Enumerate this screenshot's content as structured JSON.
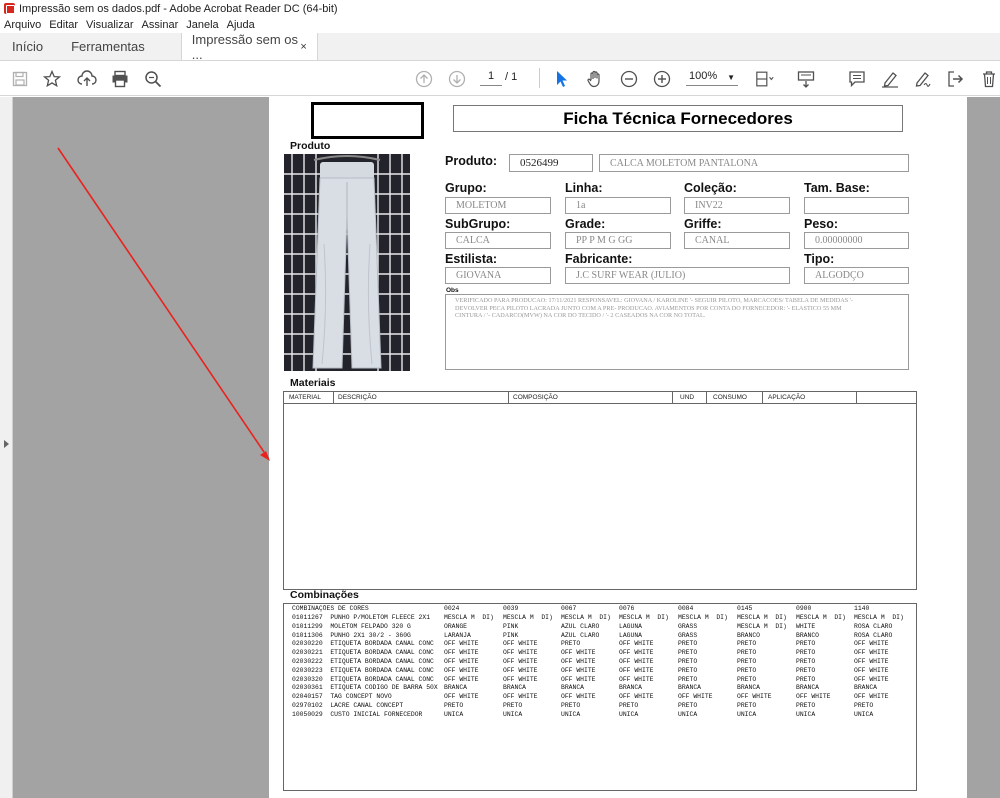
{
  "window": {
    "title": "Impressão sem os dados.pdf - Adobe Acrobat Reader DC (64-bit)"
  },
  "menu": [
    "Arquivo",
    "Editar",
    "Visualizar",
    "Assinar",
    "Janela",
    "Ajuda"
  ],
  "tabs": {
    "home": "Início",
    "tools": "Ferramentas",
    "doc": "Impressão sem os ...",
    "close": "×"
  },
  "toolbar": {
    "page_current": "1",
    "page_total": "/ 1",
    "zoom": "100%"
  },
  "form": {
    "title": "Ficha Técnica Fornecedores",
    "section_product": "Produto",
    "produto_label": "Produto:",
    "produto_code": "0526499",
    "produto_name": "CALCA MOLETOM PANTALONA",
    "grupo_label": "Grupo:",
    "grupo": "MOLETOM",
    "linha_label": "Linha:",
    "linha": "1a",
    "colecao_label": "Coleção:",
    "colecao": "INV22",
    "tambase_label": "Tam. Base:",
    "tambase": "",
    "subgrupo_label": "SubGrupo:",
    "subgrupo": "CALCA",
    "grade_label": "Grade:",
    "grade": "PP P M G GG",
    "griffe_label": "Griffe:",
    "griffe": "CANAL",
    "peso_label": "Peso:",
    "peso": "0.00000000",
    "estilista_label": "Estilista:",
    "estilista": "GIOVANA",
    "fabricante_label": "Fabricante:",
    "fabricante": "J.C SURF WEAR (JULIO)",
    "tipo_label": "Tipo:",
    "tipo": "ALGODÇO",
    "obs_label": "Obs",
    "obs_lines": [
      "VERIFICADO PARA PRODUCAO: 17/11/2021 RESPONSAVEL: GIOVANA / KAROLINE '- SEGUIR PILOTO, MARCACOES/ TABELA DE MEDIDAS '-",
      "DEVOLVER PECA PILOTO LACRADA JUNTO COM A PRE- PRODUCAO.  AVIAMENTOS POR CONTA DO FORNECEDOR: '- ELASTICO 55 MM",
      "CINTURA / '- CADARCO(MVW)  NA COR DO TECIDO / '- 2 CASEADOS NA COR NO TOTAL."
    ]
  },
  "materiais": {
    "title": "Materiais",
    "columns": [
      "MATERIAL",
      "DESCRIÇÃO",
      "COMPOSIÇÃO",
      "UND",
      "CONSUMO",
      "APLICAÇÃO"
    ]
  },
  "combinacoes": {
    "title": "Combinações",
    "header": [
      "COMBINAÇÕES DE CORES",
      "0024",
      "0039",
      "0067",
      "0076",
      "0084",
      "0145",
      "0900",
      "1140"
    ],
    "rows": [
      [
        "01011267  PUNHO P/MOLETOM FLEECE 2X1",
        "MESCLA M  DI)",
        "MESCLA M  DI)",
        "MESCLA M  DI)",
        "MESCLA M  DI)",
        "MESCLA M  DI)",
        "MESCLA M  DI)",
        "MESCLA M  DI)",
        "MESCLA M  DI)"
      ],
      [
        "01011299  MOLETOM FELPADO 320 G",
        "ORANGE",
        "PINK",
        "AZUL CLARO",
        "LAGUNA",
        "GRASS",
        "MESCLA M  DI)",
        "WHITE",
        "ROSA CLARO"
      ],
      [
        "01011306  PUNHO 2X1 30/2 - 360G",
        "LARANJA",
        "PINK",
        "AZUL CLARO",
        "LAGUNA",
        "GRASS",
        "BRANCO",
        "BRANCO",
        "ROSA CLARO"
      ],
      [
        "02030220  ETIQUETA BORDADA CANAL CONC",
        "OFF WHITE",
        "OFF WHITE",
        "PRETO",
        "OFF WHITE",
        "PRETO",
        "PRETO",
        "PRETO",
        "OFF WHITE"
      ],
      [
        "02030221  ETIQUETA BORDADA CANAL CONC",
        "OFF WHITE",
        "OFF WHITE",
        "OFF WHITE",
        "OFF WHITE",
        "PRETO",
        "PRETO",
        "PRETO",
        "OFF WHITE"
      ],
      [
        "02030222  ETIQUETA BORDADA CANAL CONC",
        "OFF WHITE",
        "OFF WHITE",
        "OFF WHITE",
        "OFF WHITE",
        "PRETO",
        "PRETO",
        "PRETO",
        "OFF WHITE"
      ],
      [
        "02030223  ETIQUETA BORDADA CANAL CONC",
        "OFF WHITE",
        "OFF WHITE",
        "OFF WHITE",
        "OFF WHITE",
        "PRETO",
        "PRETO",
        "PRETO",
        "OFF WHITE"
      ],
      [
        "02030320  ETIQUETA BORDADA CANAL CONC",
        "OFF WHITE",
        "OFF WHITE",
        "OFF WHITE",
        "OFF WHITE",
        "PRETO",
        "PRETO",
        "PRETO",
        "OFF WHITE"
      ],
      [
        "02030361  ETIQUETA CODIGO DE BARRA 50X",
        "BRANCA",
        "BRANCA",
        "BRANCA",
        "BRANCA",
        "BRANCA",
        "BRANCA",
        "BRANCA",
        "BRANCA"
      ],
      [
        "02040157  TAG CONCEPT NOVO",
        "OFF WHITE",
        "OFF WHITE",
        "OFF WHITE",
        "OFF WHITE",
        "OFF WHITE",
        "OFF WHITE",
        "OFF WHITE",
        "OFF WHITE"
      ],
      [
        "02970102  LACRE CANAL CONCEPT",
        "PRETO",
        "PRETO",
        "PRETO",
        "PRETO",
        "PRETO",
        "PRETO",
        "PRETO",
        "PRETO"
      ],
      [
        "10050029  CUSTO INICIAL FORNECEDOR",
        "UNICA",
        "UNICA",
        "UNICA",
        "UNICA",
        "UNICA",
        "UNICA",
        "UNICA",
        "UNICA"
      ]
    ]
  },
  "colors": {
    "annotation_arrow": "#e8231f",
    "acrobat_red": "#d8281e",
    "selected_tool": "#1473e6"
  },
  "icons": [
    "save-icon",
    "bookmark-star-icon",
    "upload-icon",
    "print-icon",
    "search-zoom-icon",
    "page-up-icon",
    "page-down-icon",
    "select-cursor-icon",
    "hand-icon",
    "zoom-out-icon",
    "zoom-in-icon",
    "fit-page-icon",
    "scroll-mode-icon",
    "comment-icon",
    "highlight-icon",
    "sign-icon",
    "export-icon",
    "delete-icon"
  ]
}
